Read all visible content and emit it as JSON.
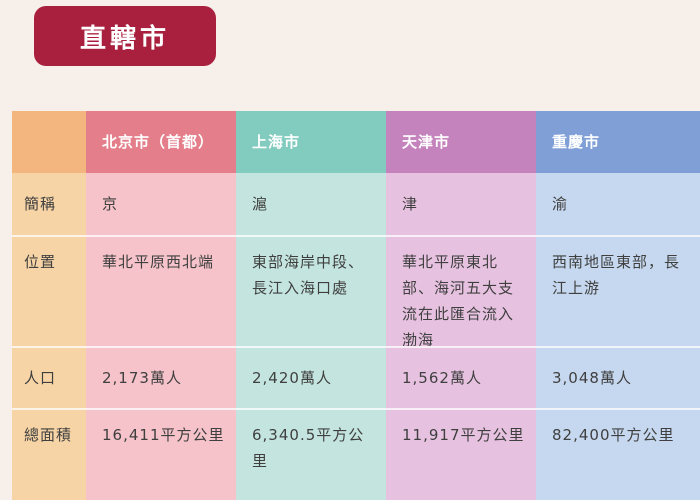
{
  "title": "直轄市",
  "table": {
    "columns": [
      "北京市（首都）",
      "上海市",
      "天津市",
      "重慶市"
    ],
    "rows": [
      {
        "label": "簡稱",
        "values": [
          "京",
          "滬",
          "津",
          "渝"
        ]
      },
      {
        "label": "位置",
        "values": [
          "華北平原西北端",
          "東部海岸中段、長江入海口處",
          "華北平原東北部、海河五大支流在此匯合流入渤海",
          "西南地區東部，長江上游"
        ]
      },
      {
        "label": "人口",
        "values": [
          "2,173萬人",
          "2,420萬人",
          "1,562萬人",
          "3,048萬人"
        ]
      },
      {
        "label": "總面積",
        "values": [
          "16,411平方公里",
          "6,340.5平方公里",
          "11,917平方公里",
          "82,400平方公里"
        ]
      }
    ]
  },
  "colors": {
    "title_bg": "#a9203e",
    "label_col": "#f7d4a6",
    "beijing": "#f5c3c9",
    "shanghai": "#c4e5df",
    "tianjin": "#e7c2e0",
    "chongqing": "#c6d8ef"
  }
}
